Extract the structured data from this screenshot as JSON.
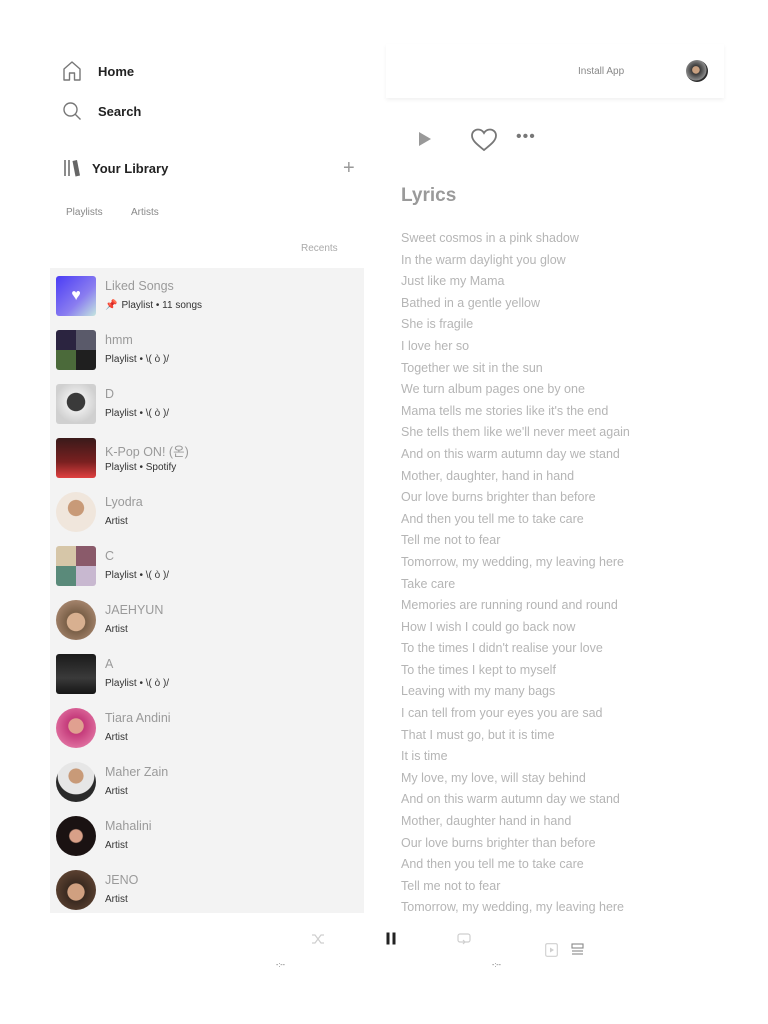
{
  "nav": {
    "home": "Home",
    "search": "Search",
    "library": "Your Library"
  },
  "filters": {
    "playlists": "Playlists",
    "artists": "Artists"
  },
  "sort_label": "Recents",
  "library_items": [
    {
      "title": "Liked Songs",
      "subtitle": "Playlist • 11 songs",
      "pinned": true,
      "kind": "liked"
    },
    {
      "title": "hmm",
      "subtitle": "Playlist • \\( ò )/",
      "kind": "collage"
    },
    {
      "title": "D",
      "subtitle": "Playlist • \\( ò )/",
      "kind": "bw"
    },
    {
      "title": "K-Pop ON! (온)",
      "subtitle": "Playlist • Spotify",
      "kind": "kpop"
    },
    {
      "title": "Lyodra",
      "subtitle": "Artist",
      "kind": "artist"
    },
    {
      "title": "C",
      "subtitle": "Playlist • \\( ò )/",
      "kind": "collage"
    },
    {
      "title": "JAEHYUN",
      "subtitle": "Artist",
      "kind": "artist"
    },
    {
      "title": "A",
      "subtitle": "Playlist • \\( ò )/",
      "kind": "perfume"
    },
    {
      "title": "Tiara Andini",
      "subtitle": "Artist",
      "kind": "artist"
    },
    {
      "title": "Maher Zain",
      "subtitle": "Artist",
      "kind": "artist"
    },
    {
      "title": "Mahalini",
      "subtitle": "Artist",
      "kind": "artist"
    },
    {
      "title": "JENO",
      "subtitle": "Artist",
      "kind": "artist"
    }
  ],
  "header": {
    "install_app": "Install App"
  },
  "lyrics": {
    "title": "Lyrics",
    "lines": [
      "Sweet cosmos in a pink shadow",
      "In the warm daylight you glow",
      "Just like my Mama",
      "Bathed in a gentle yellow",
      "She is fragile",
      "I love her so",
      "Together we sit in the sun",
      "We turn album pages one by one",
      "Mama tells me stories like it's the end",
      "She tells them like we'll never meet again",
      "And on this warm autumn day we stand",
      "Mother, daughter, hand in hand",
      "Our love burns brighter than before",
      "And then you tell me to take care",
      "Tell me not to fear",
      "Tomorrow, my wedding, my leaving here",
      "Take care",
      "Memories are running round and round",
      "How I wish I could go back now",
      "To the times I didn't realise your love",
      "To the times I kept to myself",
      "Leaving with my many bags",
      "I can tell from your eyes you are sad",
      "That I must go, but it is time",
      "It is time",
      "My love, my love, will stay behind",
      "And on this warm autumn day we stand",
      "Mother, daughter hand in hand",
      "Our love burns brighter than before",
      "And then you tell me to take care",
      "Tell me not to fear",
      "Tomorrow, my wedding, my leaving here"
    ]
  },
  "player": {
    "elapsed": "-:--",
    "duration": "-:--"
  },
  "colors": {
    "accent": "#1db954",
    "liked_gradient_start": "#4a3cf5",
    "liked_gradient_end": "#c4e6df"
  }
}
